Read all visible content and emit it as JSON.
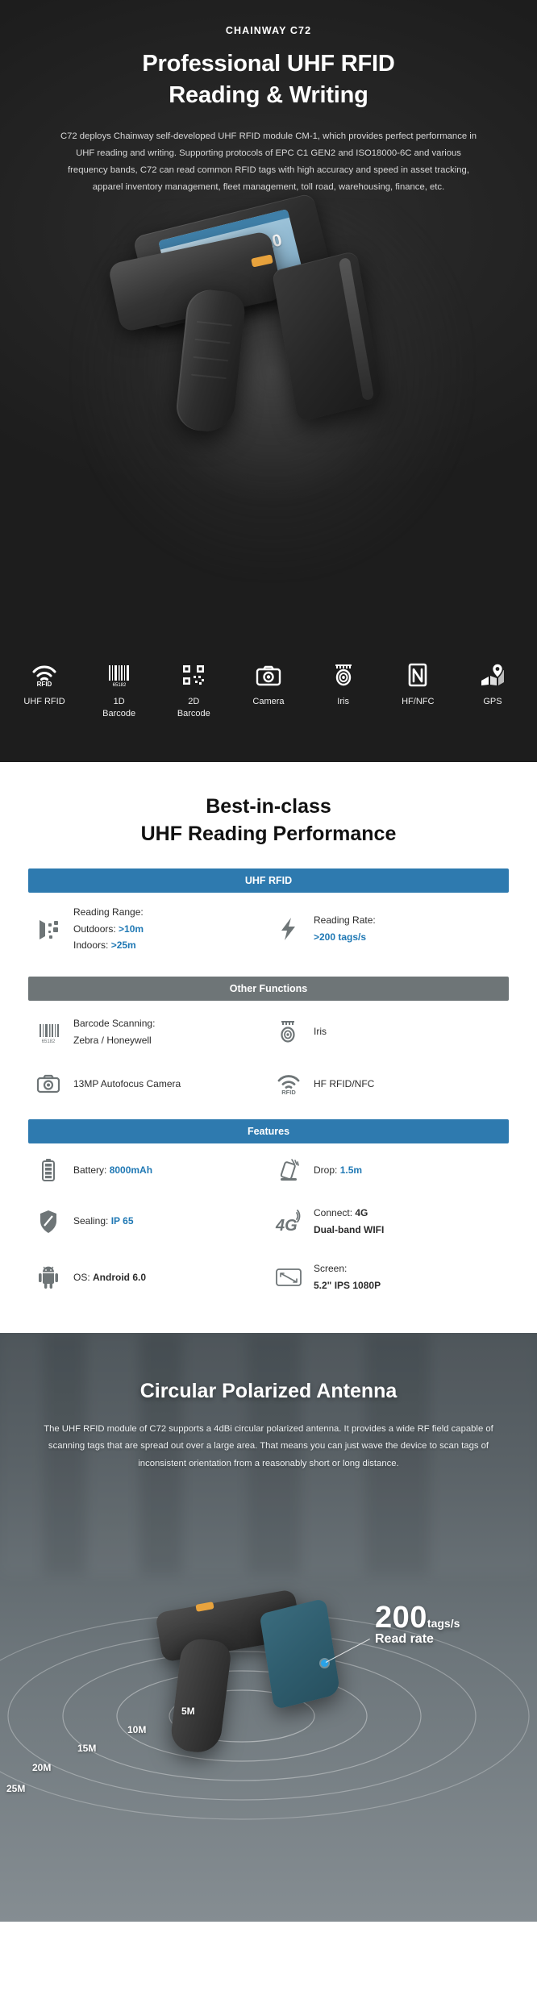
{
  "hero": {
    "brand": "CHAINWAY  C72",
    "title_line1": "Professional UHF RFID",
    "title_line2": "Reading & Writing",
    "description": "C72 deploys Chainway self-developed UHF RFID module CM-1, which provides perfect performance in UHF reading and writing. Supporting protocols of EPC C1 GEN2 and ISO18000-6C and various frequency bands, C72 can read common RFID tags with high accuracy and speed in asset tracking, apparel inventory management, fleet management, toll road, warehousing, finance, etc.",
    "screen_value": "10",
    "features": [
      {
        "icon": "rfid-wifi-icon",
        "label": "UHF RFID"
      },
      {
        "icon": "barcode-1d-icon",
        "label": "1D\nBarcode"
      },
      {
        "icon": "qr-2d-icon",
        "label": "2D\nBarcode"
      },
      {
        "icon": "camera-icon",
        "label": "Camera"
      },
      {
        "icon": "iris-icon",
        "label": "Iris"
      },
      {
        "icon": "nfc-icon",
        "label": "HF/NFC"
      },
      {
        "icon": "gps-icon",
        "label": "GPS"
      }
    ]
  },
  "specs": {
    "title_line1": "Best-in-class",
    "title_line2": "UHF Reading Performance",
    "accent_blue": "#2e7aaf",
    "accent_gray": "#6e7577",
    "value_blue": "#1f78b4",
    "sections": [
      {
        "header": "UHF RFID",
        "style": "blue",
        "rows": [
          {
            "icon": "rfid-signal-icon",
            "l1": "Reading Range:",
            "l2_label": "Outdoors: ",
            "l2_value": ">10m",
            "l3_label": "Indoors: ",
            "l3_value": ">25m"
          },
          {
            "icon": "lightning-icon",
            "l1": "Reading Rate:",
            "l2_label": "",
            "l2_value": ">200 tags/s",
            "l3_label": "",
            "l3_value": ""
          }
        ]
      },
      {
        "header": "Other Functions",
        "style": "gray",
        "rows": [
          {
            "icon": "barcode-icon",
            "l1": "Barcode Scanning:",
            "l2_label": "Zebra / Honeywell",
            "l2_value": "",
            "l3_label": "",
            "l3_value": ""
          },
          {
            "icon": "iris-icon",
            "l1": "Iris",
            "l2_label": "",
            "l2_value": "",
            "l3_label": "",
            "l3_value": ""
          },
          {
            "icon": "camera-icon",
            "l1": "13MP Autofocus Camera",
            "l2_label": "",
            "l2_value": "",
            "l3_label": "",
            "l3_value": ""
          },
          {
            "icon": "rfid-wifi-icon",
            "l1": "HF RFID/NFC",
            "l2_label": "",
            "l2_value": "",
            "l3_label": "",
            "l3_value": ""
          }
        ]
      },
      {
        "header": "Features",
        "style": "blue",
        "rows": [
          {
            "icon": "battery-icon",
            "l1_label": "Battery: ",
            "l1_value": "8000mAh"
          },
          {
            "icon": "drop-icon",
            "l1_label": "Drop: ",
            "l1_value": "1.5m"
          },
          {
            "icon": "shield-icon",
            "l1_label": "Sealing: ",
            "l1_value": "IP 65"
          },
          {
            "icon": "4g-icon",
            "l1_label": "Connect: ",
            "l1_value": "4G",
            "l2_value": "Dual-band WIFI"
          },
          {
            "icon": "android-icon",
            "l1_label": "OS: ",
            "l1_value": "Android 6.0"
          },
          {
            "icon": "screen-icon",
            "l1_label": "Screen:",
            "l1_value": "",
            "l2_value": "5.2\" IPS 1080P"
          }
        ]
      }
    ]
  },
  "antenna": {
    "title": "Circular Polarized Antenna",
    "description": "The UHF RFID module of C72 supports a 4dBi circular polarized antenna. It provides a wide RF field capable of scanning tags that are spread out over a large area. That means you can just wave the device to scan tags of inconsistent orientation from a reasonably short or long distance.",
    "callout_value": "200",
    "callout_unit": "tags/s",
    "callout_sub": "Read rate",
    "callout_dot_color": "#29a3e8",
    "range_rings": [
      "5M",
      "10M",
      "15M",
      "20M",
      "25M"
    ]
  }
}
